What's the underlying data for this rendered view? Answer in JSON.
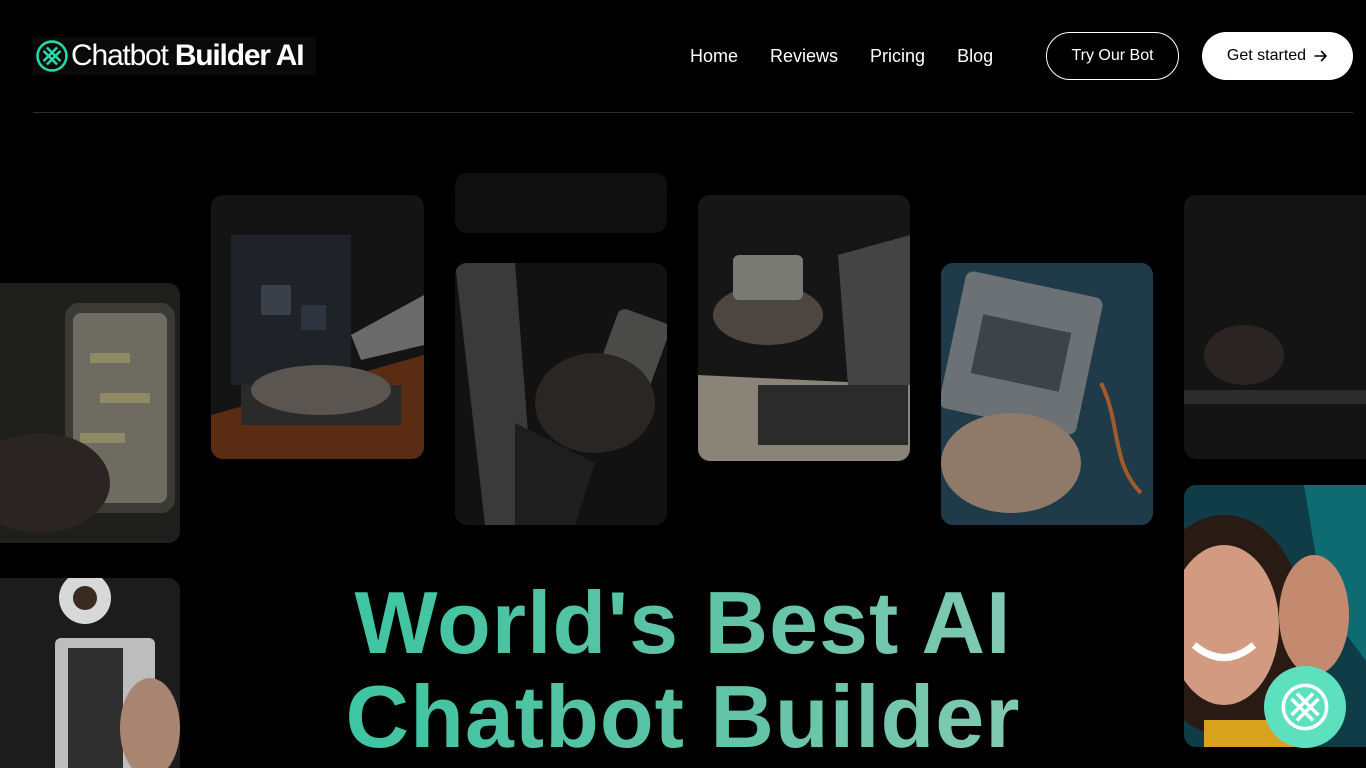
{
  "brand": {
    "name_light": "Chatbot",
    "name_bold": "Builder AI",
    "accent": "#1fc8a0"
  },
  "nav": {
    "items": [
      {
        "label": "Home"
      },
      {
        "label": "Reviews"
      },
      {
        "label": "Pricing"
      },
      {
        "label": "Blog"
      }
    ]
  },
  "actions": {
    "try_bot": "Try Our Bot",
    "get_started": "Get started",
    "get_started_icon": "arrow-right-icon"
  },
  "hero": {
    "title_line1": "World's Best AI",
    "title_line2": "Chatbot Builder"
  },
  "chat_widget": {
    "icon": "chatbot-logo-icon",
    "color": "#5de0bd"
  },
  "colors": {
    "background": "#000000",
    "divider": "#2e2e2e",
    "title_gradient": [
      "#1fc8a0",
      "#a8d0c4"
    ]
  }
}
